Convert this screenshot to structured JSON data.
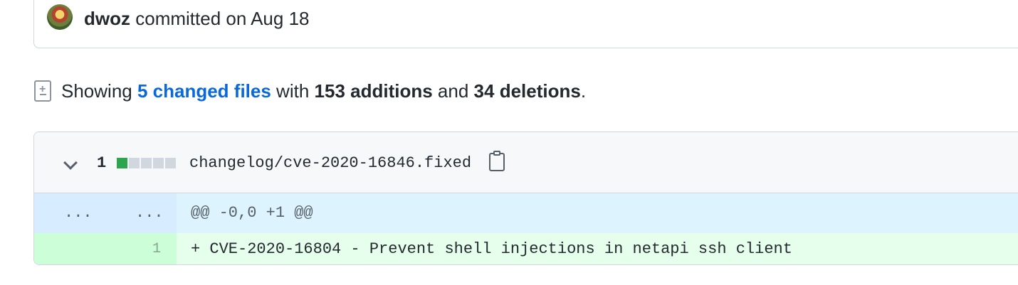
{
  "commit": {
    "author": "dwoz",
    "action": "committed on Aug 18"
  },
  "summary": {
    "prefix": "Showing",
    "changed_files": "5 changed files",
    "with": "with",
    "additions": "153 additions",
    "and": "and",
    "deletions": "34 deletions",
    "end": "."
  },
  "file": {
    "change_count": "1",
    "blocks": [
      "#2da44e",
      "#d0d7de",
      "#d0d7de",
      "#d0d7de",
      "#d0d7de"
    ],
    "name": "changelog/cve-2020-16846.fixed"
  },
  "diff": {
    "hunk_left": "...",
    "hunk_right": "...",
    "hunk_header": "@@ -0,0 +1 @@",
    "lines": [
      {
        "new_num": "1",
        "text": "+ CVE-2020-16804 - Prevent shell injections in netapi ssh client"
      }
    ]
  },
  "colors": {
    "link": "#0969da",
    "addition": "#2da44e"
  }
}
